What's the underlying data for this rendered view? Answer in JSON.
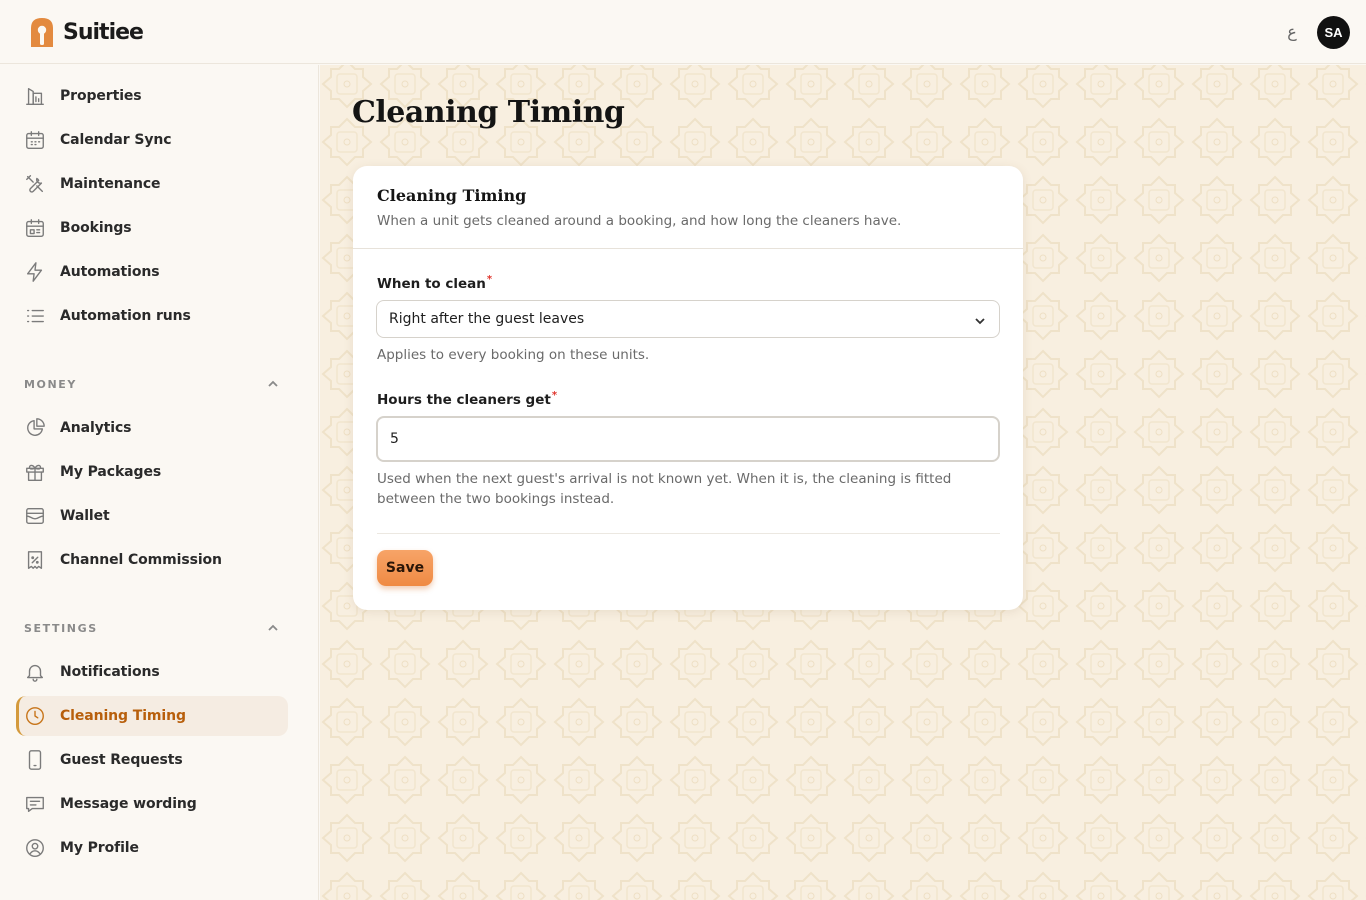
{
  "app": {
    "name": "Suitiee",
    "language_toggle": "ع",
    "avatar_initials": "SA",
    "colors": {
      "accent": "#ef8a43",
      "active_nav": "#b85f0c",
      "background": "#f8efe0"
    }
  },
  "sidebar": {
    "items_top": [
      {
        "label": "Properties",
        "icon": "building-chart-icon"
      },
      {
        "label": "Calendar Sync",
        "icon": "calendar-icon"
      },
      {
        "label": "Maintenance",
        "icon": "tools-icon"
      },
      {
        "label": "Bookings",
        "icon": "calendar-grid-icon"
      },
      {
        "label": "Automations",
        "icon": "lightning-icon"
      },
      {
        "label": "Automation runs",
        "icon": "list-icon"
      }
    ],
    "money": {
      "label": "MONEY",
      "items": [
        {
          "label": "Analytics",
          "icon": "pie-chart-icon"
        },
        {
          "label": "My Packages",
          "icon": "gift-icon"
        },
        {
          "label": "Wallet",
          "icon": "wallet-icon"
        },
        {
          "label": "Channel Commission",
          "icon": "receipt-percent-icon"
        }
      ]
    },
    "settings": {
      "label": "SETTINGS",
      "items": [
        {
          "label": "Notifications",
          "icon": "bell-icon"
        },
        {
          "label": "Cleaning Timing",
          "icon": "clock-icon",
          "active": true
        },
        {
          "label": "Guest Requests",
          "icon": "phone-icon"
        },
        {
          "label": "Message wording",
          "icon": "chat-icon"
        },
        {
          "label": "My Profile",
          "icon": "user-circle-icon"
        }
      ]
    }
  },
  "page": {
    "title": "Cleaning Timing",
    "card": {
      "title": "Cleaning Timing",
      "description": "When a unit gets cleaned around a booking, and how long the cleaners have.",
      "when_to_clean": {
        "label": "When to clean",
        "required_mark": "*",
        "selected": "Right after the guest leaves",
        "help": "Applies to every booking on these units."
      },
      "hours": {
        "label": "Hours the cleaners get",
        "required_mark": "*",
        "value": "5",
        "help": "Used when the next guest's arrival is not known yet. When it is, the cleaning is fitted between the two bookings instead."
      },
      "save_label": "Save"
    }
  }
}
